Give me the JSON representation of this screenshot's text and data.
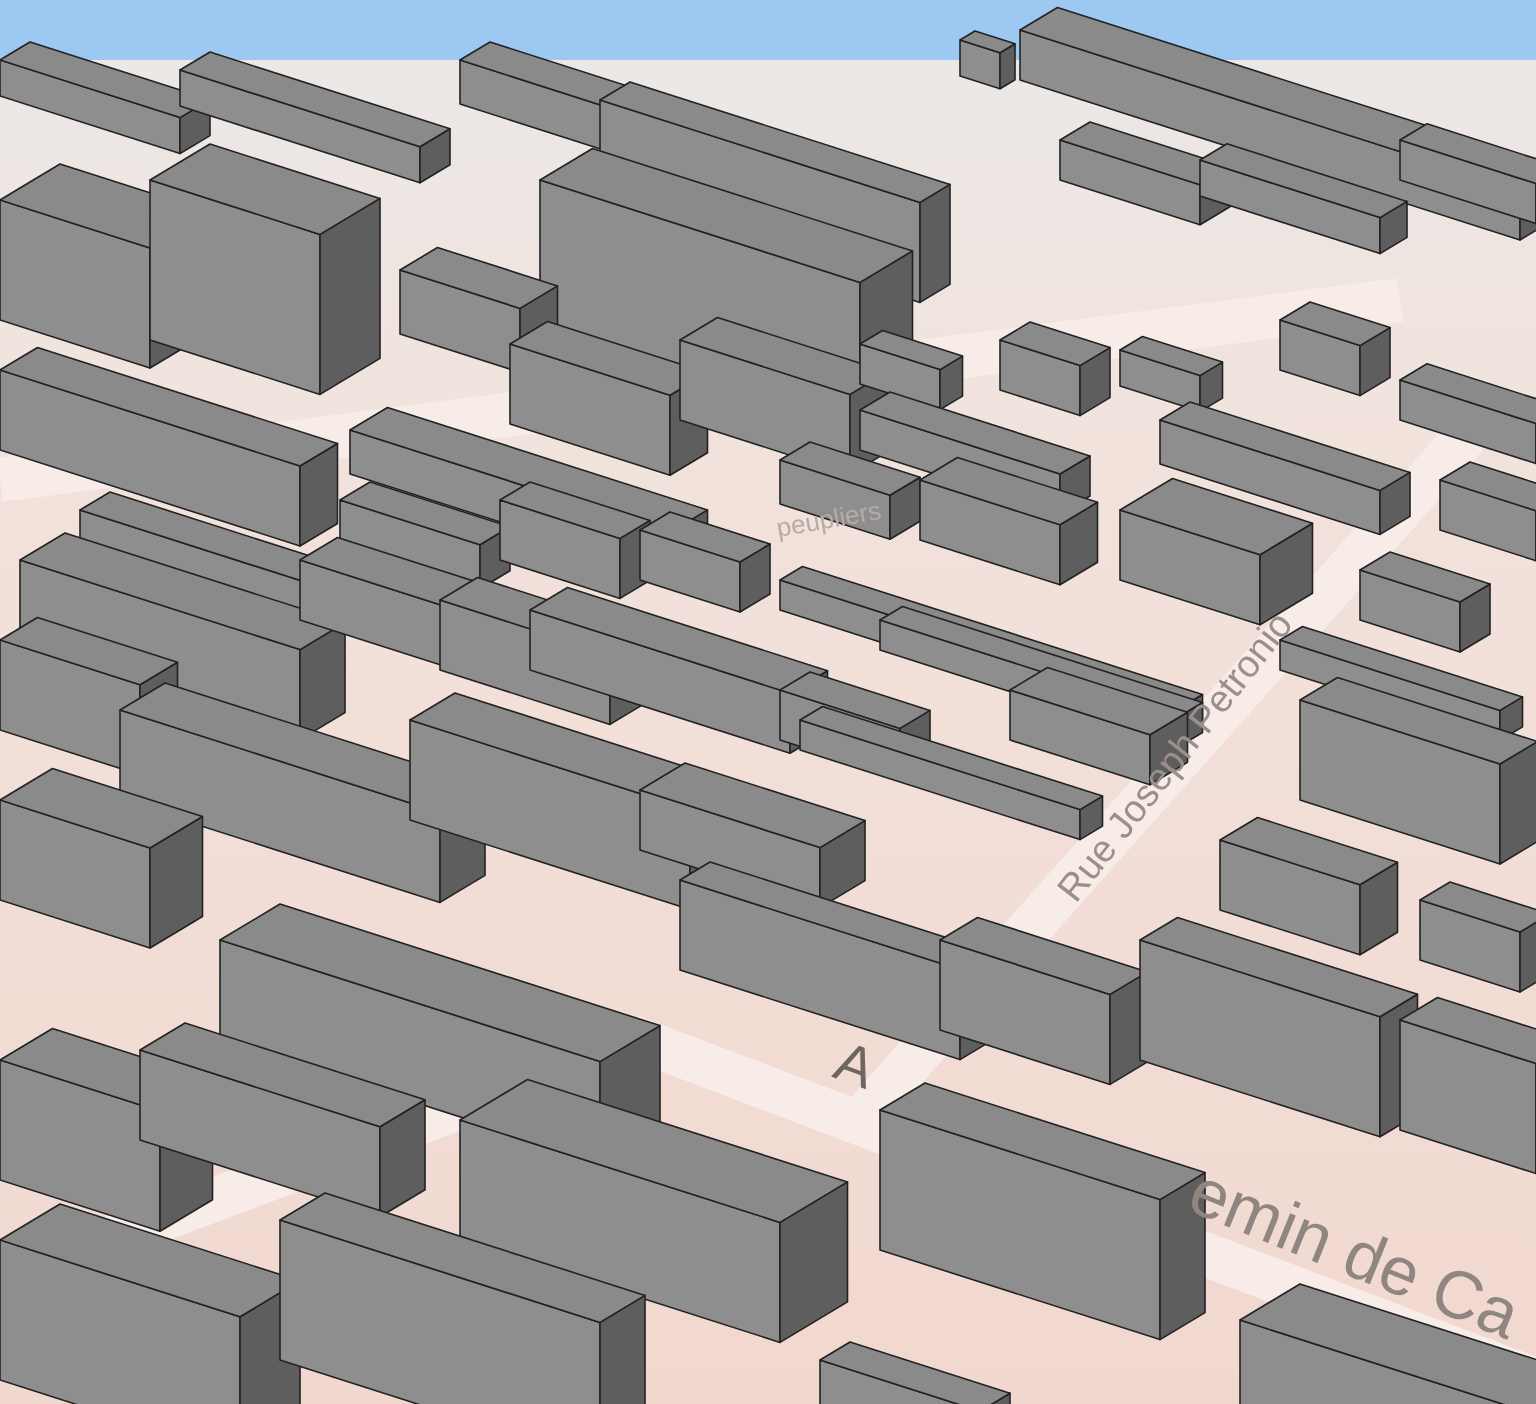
{
  "map": {
    "street_labels": [
      {
        "text": "peupliers"
      },
      {
        "text": "Rue Joseph Petronio"
      },
      {
        "text": "A"
      },
      {
        "text": "emin de Ca"
      }
    ]
  }
}
